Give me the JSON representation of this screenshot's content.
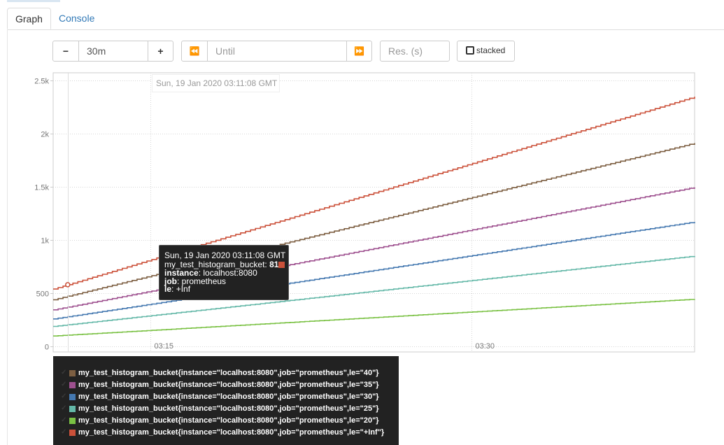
{
  "tabs": [
    {
      "label": "Graph",
      "active": true
    },
    {
      "label": "Console",
      "active": false
    }
  ],
  "controls": {
    "range_minus": "−",
    "range_value": "30m",
    "range_plus": "+",
    "back": "⏪",
    "until_placeholder": "Until",
    "forward": "⏩",
    "res_placeholder": "Res. (s)",
    "stacked_label": "stacked"
  },
  "hover": {
    "timestamp": "Sun, 19 Jan 2020 03:11:08 GMT"
  },
  "tooltip": {
    "timestamp": "Sun, 19 Jan 2020 03:11:08 GMT",
    "metric": "my_test_histogram_bucket",
    "value": "81",
    "instance_key": "instance",
    "instance_val": "localhost:8080",
    "job_key": "job",
    "job_val": "prometheus",
    "le_key": "le",
    "le_val": "+Inf"
  },
  "chart_data": {
    "type": "line",
    "y_ticks": [
      {
        "label": "2.5k",
        "value": 2500
      },
      {
        "label": "2k",
        "value": 2000
      },
      {
        "label": "1.5k",
        "value": 1500
      },
      {
        "label": "1k",
        "value": 1000
      },
      {
        "label": "500",
        "value": 500
      },
      {
        "label": "0",
        "value": 0
      }
    ],
    "x_ticks": [
      {
        "label": "03:15",
        "minutes": 15
      },
      {
        "label": "03:30",
        "minutes": 30
      }
    ],
    "ylim": [
      -50,
      2570
    ],
    "x_range_minutes": [
      10.45,
      40.45
    ],
    "hover_minutes": 11.13,
    "series": [
      {
        "name": "my_test_histogram_bucket{instance=\"localhost:8080\",job=\"prometheus\",le=\"40\"}",
        "color": "#7d5f42",
        "x_minutes": [
          10.45,
          40.45
        ],
        "y": [
          440,
          1910
        ]
      },
      {
        "name": "my_test_histogram_bucket{instance=\"localhost:8080\",job=\"prometheus\",le=\"35\"}",
        "color": "#9e508f",
        "x_minutes": [
          10.45,
          40.45
        ],
        "y": [
          345,
          1495
        ]
      },
      {
        "name": "my_test_histogram_bucket{instance=\"localhost:8080\",job=\"prometheus\",le=\"30\"}",
        "color": "#4478b0",
        "x_minutes": [
          10.45,
          40.45
        ],
        "y": [
          260,
          1170
        ]
      },
      {
        "name": "my_test_histogram_bucket{instance=\"localhost:8080\",job=\"prometheus\",le=\"25\"}",
        "color": "#64b8a8",
        "x_minutes": [
          10.45,
          40.45
        ],
        "y": [
          190,
          850
        ]
      },
      {
        "name": "my_test_histogram_bucket{instance=\"localhost:8080\",job=\"prometheus\",le=\"20\"}",
        "color": "#7ac143",
        "x_minutes": [
          10.45,
          40.45
        ],
        "y": [
          100,
          445
        ]
      },
      {
        "name": "my_test_histogram_bucket{instance=\"localhost:8080\",job=\"prometheus\",le=\"+Inf\"}",
        "color": "#cb513a",
        "x_minutes": [
          10.45,
          40.45
        ],
        "y": [
          540,
          2345
        ]
      }
    ]
  },
  "legend": {
    "check_glyph": "✓"
  }
}
